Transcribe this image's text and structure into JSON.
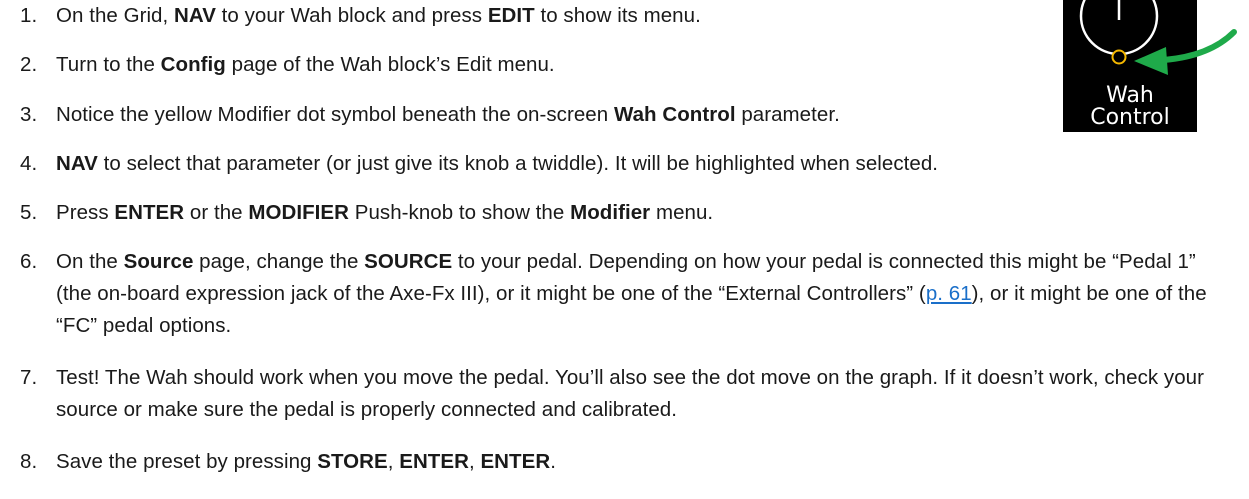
{
  "steps": [
    {
      "num": "1.",
      "parts": [
        {
          "t": "On the Grid, "
        },
        {
          "t": "NAV",
          "b": true
        },
        {
          "t": " to your Wah block and press "
        },
        {
          "t": "EDIT",
          "b": true
        },
        {
          "t": " to show its menu."
        }
      ]
    },
    {
      "num": "2.",
      "parts": [
        {
          "t": "Turn to the "
        },
        {
          "t": "Config",
          "b": true
        },
        {
          "t": " page of the Wah block’s Edit menu."
        }
      ]
    },
    {
      "num": "3.",
      "parts": [
        {
          "t": "Notice the yellow Modifier dot symbol beneath the on-screen "
        },
        {
          "t": "Wah Control",
          "b": true
        },
        {
          "t": " parameter."
        }
      ]
    },
    {
      "num": "4.",
      "parts": [
        {
          "t": "NAV",
          "b": true
        },
        {
          "t": " to select that parameter (or just give its knob a twiddle). It will be highlighted when selected."
        }
      ]
    },
    {
      "num": "5.",
      "parts": [
        {
          "t": "Press "
        },
        {
          "t": "ENTER",
          "b": true
        },
        {
          "t": " or the "
        },
        {
          "t": "MODIFIER",
          "b": true
        },
        {
          "t": " Push-knob to show the "
        },
        {
          "t": "Modifier",
          "b": true
        },
        {
          "t": " menu."
        }
      ]
    },
    {
      "num": "6.",
      "parts": [
        {
          "t": "On the "
        },
        {
          "t": "Source",
          "b": true
        },
        {
          "t": " page, change the "
        },
        {
          "t": "SOURCE",
          "b": true
        },
        {
          "t": " to your pedal. Depending on how your pedal is connected this might be “Pedal 1” (the on-board expression jack of the Axe-Fx III), or it might be one of the “External Controllers” ("
        },
        {
          "t": "p. 61",
          "link": true
        },
        {
          "t": "), or it might be one of the “FC” pedal options."
        }
      ]
    },
    {
      "num": "7.",
      "parts": [
        {
          "t": "Test! The Wah should work when you move the pedal. You’ll also see the dot move on the graph. If it doesn’t work, check your source or make sure the pedal is properly connected and calibrated."
        }
      ]
    },
    {
      "num": "8.",
      "parts": [
        {
          "t": "Save the preset by pressing "
        },
        {
          "t": "STORE",
          "b": true
        },
        {
          "t": ", "
        },
        {
          "t": "ENTER",
          "b": true
        },
        {
          "t": ", "
        },
        {
          "t": "ENTER",
          "b": true
        },
        {
          "t": "."
        }
      ]
    }
  ],
  "figure": {
    "label_line1": "Wah",
    "label_line2": "Control",
    "colors": {
      "background": "#000000",
      "knob": "#ffffff",
      "modifier_dot": "#f5b800",
      "arrow": "#1faa4a"
    }
  }
}
